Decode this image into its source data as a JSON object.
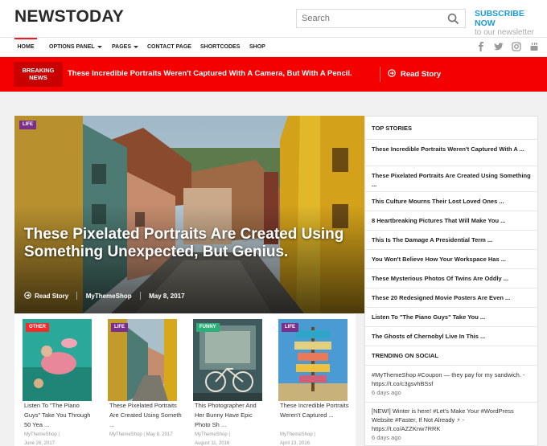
{
  "header": {
    "logo": "NEWSTODAY",
    "search_placeholder": "Search",
    "subscribe_title": "SUBSCRIBE NOW",
    "subscribe_sub": "to our newsletter"
  },
  "nav": {
    "items": [
      "HOME",
      "OPTIONS PANEL",
      "PAGES",
      "CONTACT PAGE",
      "SHORTCODES",
      "SHOP"
    ]
  },
  "breaking": {
    "label_line1": "BREAKING",
    "label_line2": "NEWS",
    "headline": "These Incredible Portraits Weren't Captured With A Camera, But With A Pencil.",
    "read_label": "Read Story"
  },
  "hero": {
    "tag": "LIFE",
    "title": "These Pixelated Portraits Are Created Using Something Unexpected, But Genius.",
    "read_label": "Read Story",
    "author": "MyThemeShop",
    "date": "May 8, 2017"
  },
  "cards": [
    {
      "tag": "OTHER",
      "title": "Listen To \"The Piano Guys\" Take You Through 50 Yea ...",
      "author": "MyThemeShop |",
      "date": "June 26, 2017"
    },
    {
      "tag": "LIFE",
      "title": "These Pixelated Portraits Are Created Using Someth ...",
      "author": "MyThemeShop | May 8, 2017",
      "date": ""
    },
    {
      "tag": "FUNNY",
      "title": "This Photographer And Her Bunny Have Epic Photo Sh ...",
      "author": "MyThemeShop |",
      "date": "August 11, 2016"
    },
    {
      "tag": "LIFE",
      "title": "These Incredible Portraits Weren't Captured ...",
      "author": "MyThemeShop |",
      "date": "April 13, 2016"
    }
  ],
  "sidebar": {
    "top_stories_heading": "TOP STORIES",
    "top_stories": [
      "These Incredible Portraits Weren't Captured With A ...",
      "These Pixelated Portraits Are Created Using Something ...",
      "This Culture Mourns Their Lost Loved Ones ...",
      "8 Heartbreaking Pictures That Will Make You ...",
      "This Is The Damage A Presidential Term ...",
      "You Won't Believe How Your Workspace Has ...",
      "These Mysterious Photos Of Twins Are Oddly ...",
      "These 20 Redesigned Movie Posters Are Even ...",
      "Listen To \"The Piano Guys\" Take You ...",
      "The Ghosts of Chernobyl Live In This ..."
    ],
    "trending_heading": "TRENDING ON SOCIAL",
    "tweets": [
      {
        "text": "#MyThemeShop #Coupon — they pay for my sandwich. - https://t.co/c3gsvhBSsf",
        "time": "6 days ago"
      },
      {
        "text": "[NEW!] Winter is here! #Let's Make Your #WordPress Website #Faster, If Not Already ⚡ - https://t.co/AZZKnw7RRK",
        "time": "6 days ago"
      }
    ]
  },
  "colors": {
    "accent": "#f50000",
    "link": "#1d9bd7"
  }
}
